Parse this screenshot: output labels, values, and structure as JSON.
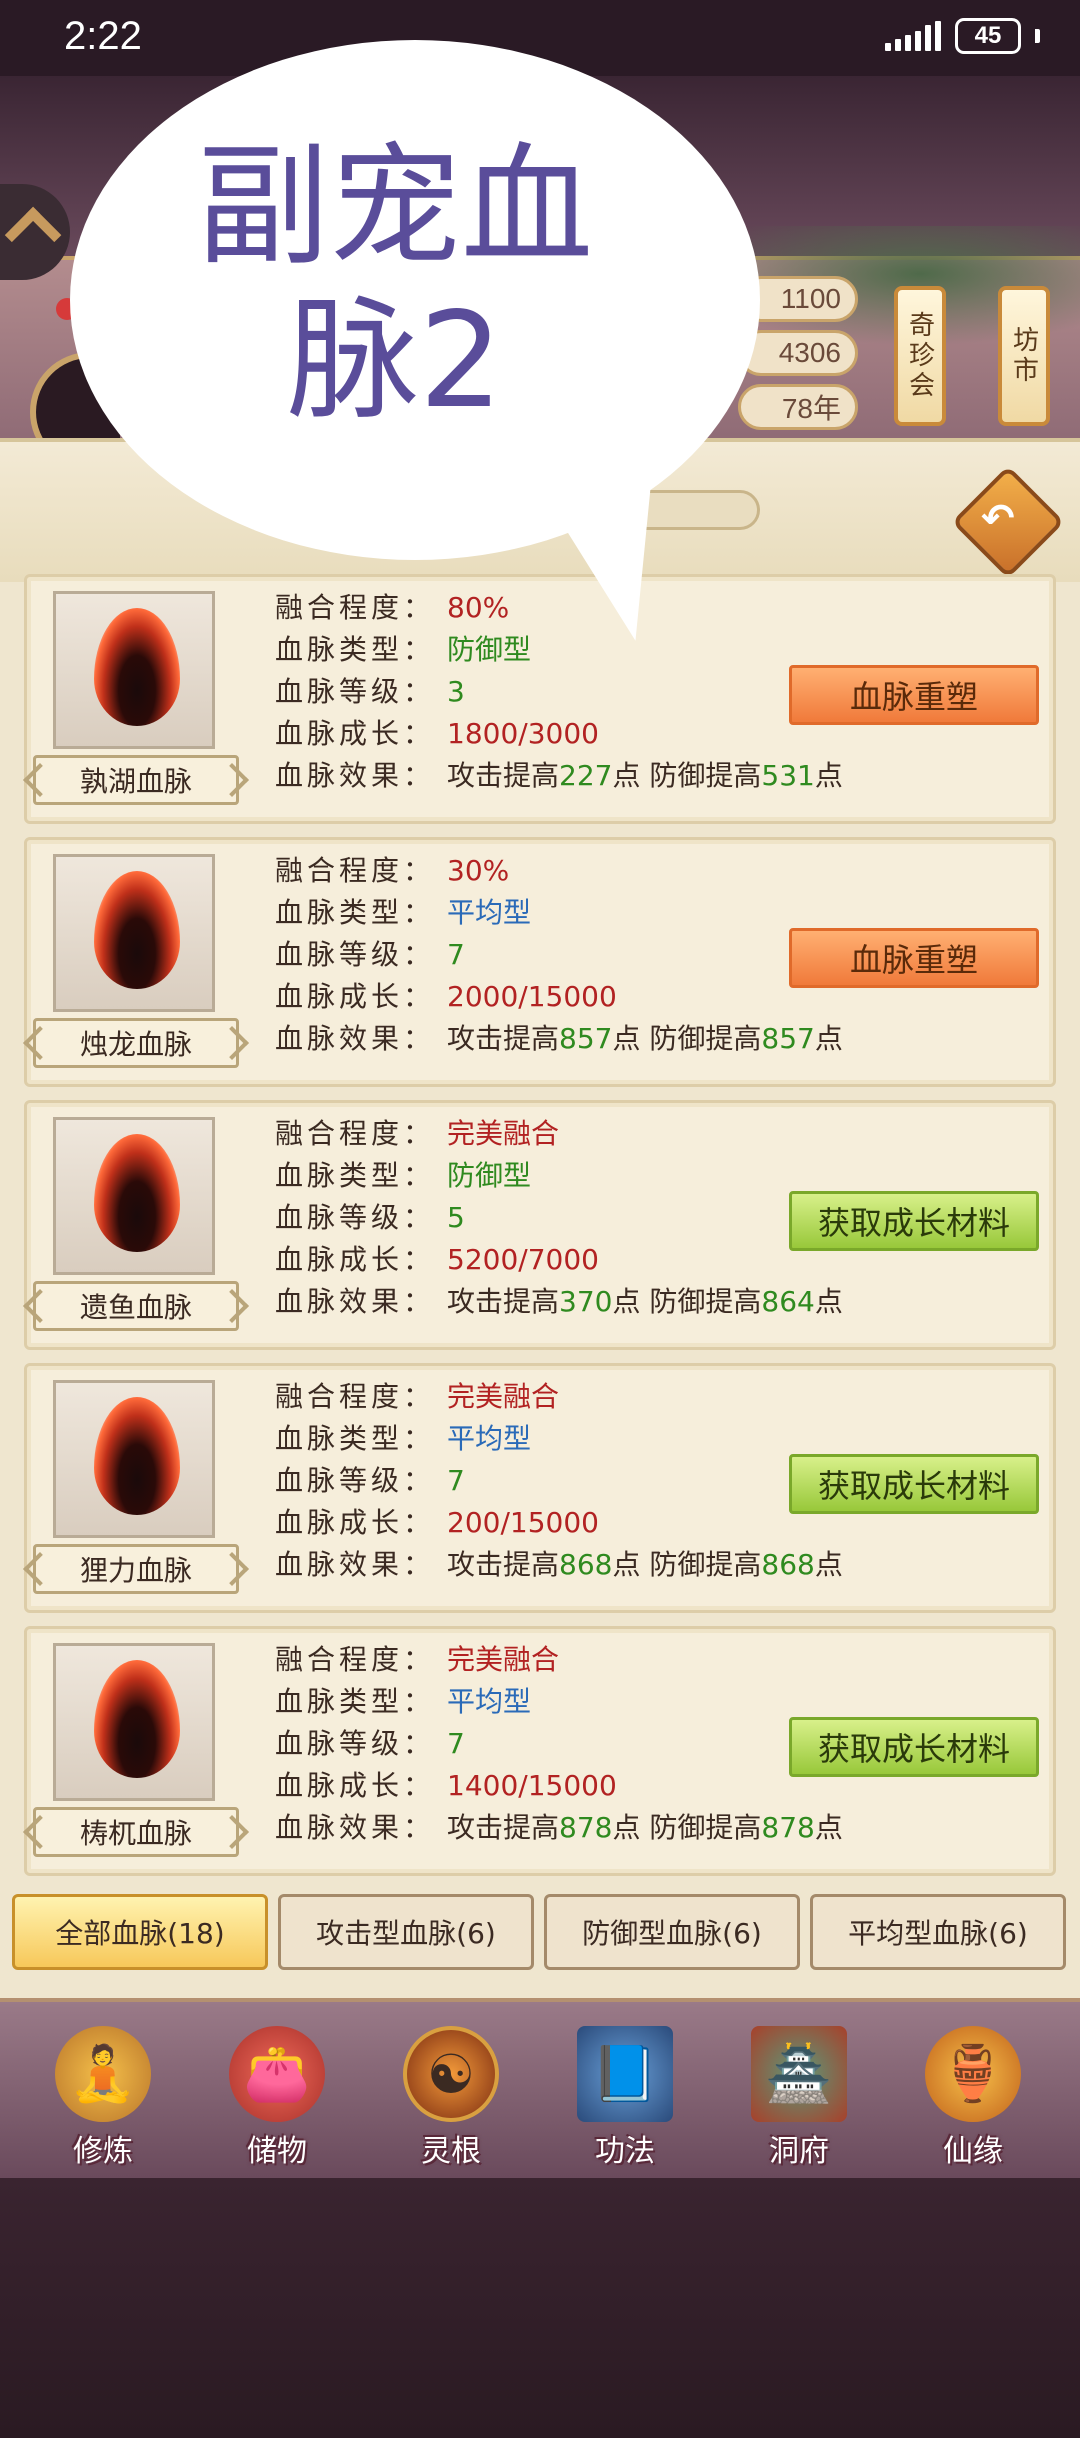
{
  "status": {
    "time": "2:22",
    "battery": "45"
  },
  "header": {
    "resources": [
      "1100",
      "4306",
      "78年"
    ],
    "scroll_buttons": [
      "奇珍会",
      "坊市"
    ]
  },
  "overlay": {
    "line1": "副宠血",
    "line2": "脉2"
  },
  "bloodlines": [
    {
      "name": "孰湖血脉",
      "fusion": "80%",
      "type": "防御型",
      "level": "3",
      "growth": "1800/3000",
      "effect_prefix": "攻击提高",
      "atk": "227",
      "mid": "点 防御提高",
      "def": "531",
      "suffix": "点",
      "action": "血脉重塑",
      "action_style": "orange",
      "fusion_color": "red",
      "type_color": "green"
    },
    {
      "name": "烛龙血脉",
      "fusion": "30%",
      "type": "平均型",
      "level": "7",
      "growth": "2000/15000",
      "effect_prefix": "攻击提高",
      "atk": "857",
      "mid": "点 防御提高",
      "def": "857",
      "suffix": "点",
      "action": "血脉重塑",
      "action_style": "orange",
      "fusion_color": "red",
      "type_color": "blue"
    },
    {
      "name": "遗鱼血脉",
      "fusion": "完美融合",
      "type": "防御型",
      "level": "5",
      "growth": "5200/7000",
      "effect_prefix": "攻击提高",
      "atk": "370",
      "mid": "点 防御提高",
      "def": "864",
      "suffix": "点",
      "action": "获取成长材料",
      "action_style": "green",
      "fusion_color": "red",
      "type_color": "green"
    },
    {
      "name": "狸力血脉",
      "fusion": "完美融合",
      "type": "平均型",
      "level": "7",
      "growth": "200/15000",
      "effect_prefix": "攻击提高",
      "atk": "868",
      "mid": "点 防御提高",
      "def": "868",
      "suffix": "点",
      "action": "获取成长材料",
      "action_style": "green",
      "fusion_color": "red",
      "type_color": "blue"
    },
    {
      "name": "梼杌血脉",
      "fusion": "完美融合",
      "type": "平均型",
      "level": "7",
      "growth": "1400/15000",
      "effect_prefix": "攻击提高",
      "atk": "878",
      "mid": "点 防御提高",
      "def": "878",
      "suffix": "点",
      "action": "获取成长材料",
      "action_style": "green",
      "fusion_color": "red",
      "type_color": "blue"
    }
  ],
  "labels": {
    "fusion": "融合程度：",
    "type": "血脉类型：",
    "level": "血脉等级：",
    "growth": "血脉成长：",
    "effect": "血脉效果："
  },
  "tabs": [
    "全部血脉(18)",
    "攻击型血脉(6)",
    "防御型血脉(6)",
    "平均型血脉(6)"
  ],
  "nav": [
    {
      "label": "修炼",
      "icon": "cultivation-icon"
    },
    {
      "label": "储物",
      "icon": "storage-bag-icon"
    },
    {
      "label": "灵根",
      "icon": "spirit-root-icon"
    },
    {
      "label": "功法",
      "icon": "scripture-book-icon"
    },
    {
      "label": "洞府",
      "icon": "cave-mansion-icon"
    },
    {
      "label": "仙缘",
      "icon": "gourd-icon"
    }
  ],
  "colors": {
    "red": "#b22222",
    "green": "#2f8a1f",
    "blue": "#2a6ab8"
  }
}
